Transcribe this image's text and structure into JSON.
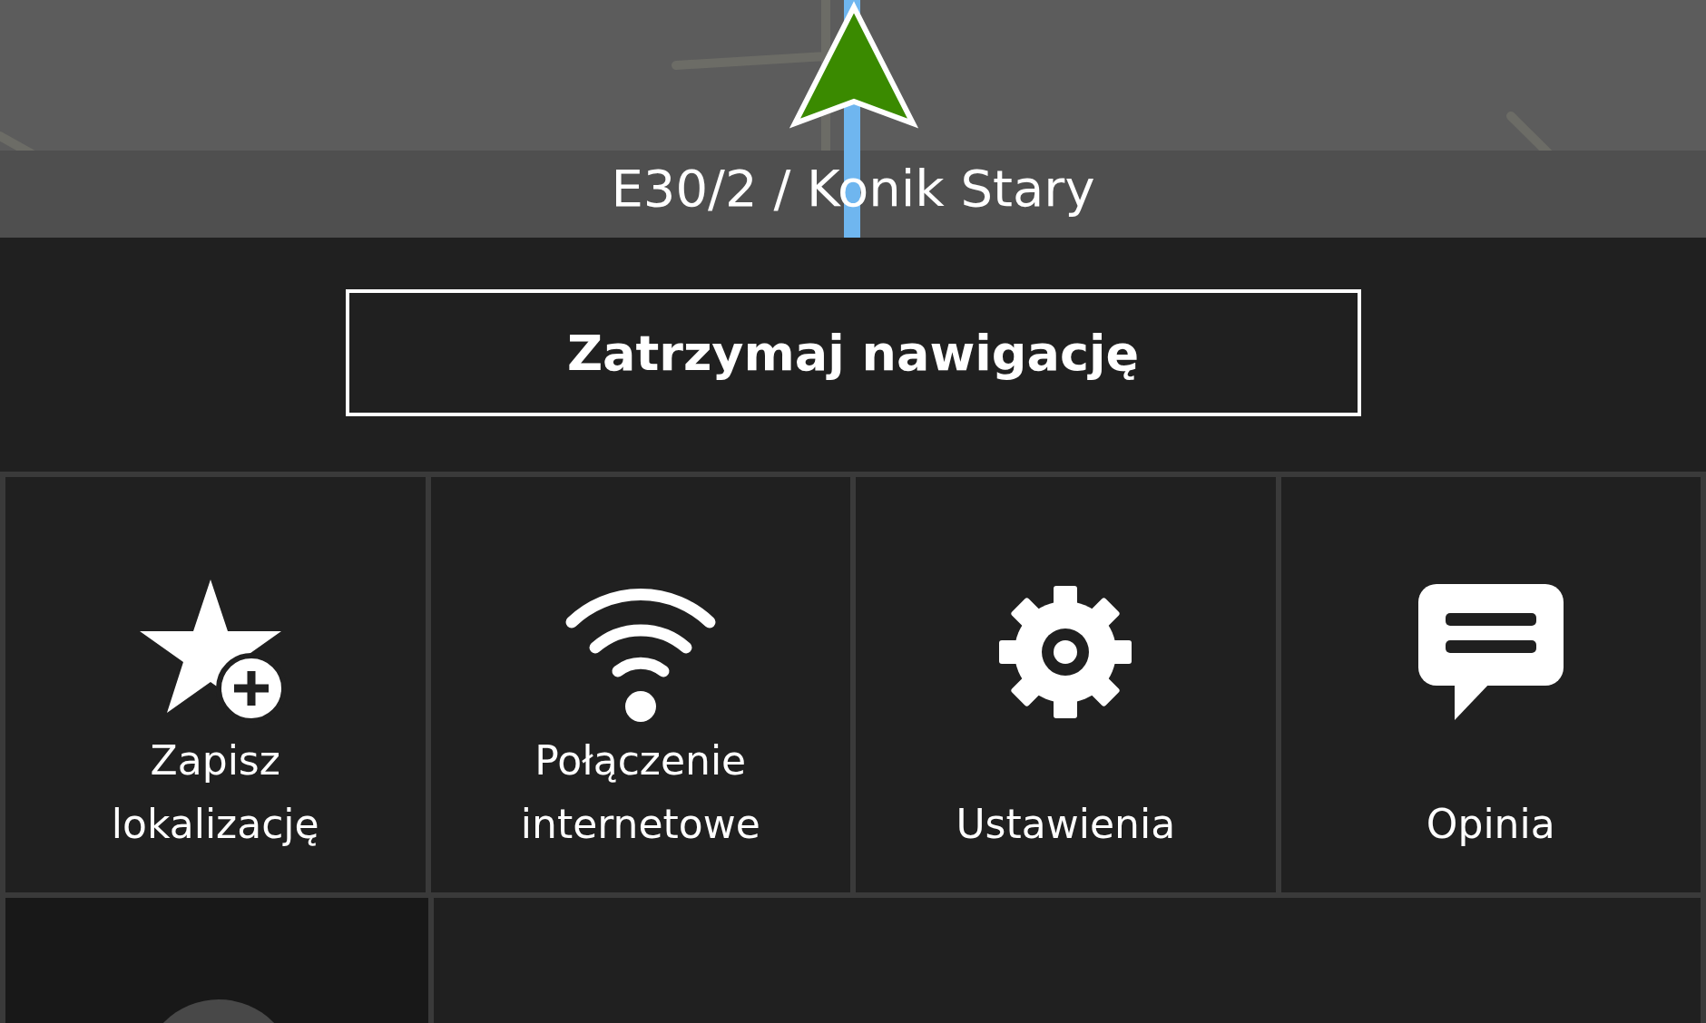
{
  "map": {
    "street_name": "E30/2 / Konik Stary"
  },
  "stop_button": {
    "label": "Zatrzymaj nawigację"
  },
  "tiles": [
    {
      "kind": "save",
      "label": "Zapisz\nlokalizację"
    },
    {
      "kind": "wifi",
      "label": "Połączenie\ninternetowe"
    },
    {
      "kind": "settings",
      "label": "Ustawienia"
    },
    {
      "kind": "feedback",
      "label": "Opinia"
    }
  ]
}
